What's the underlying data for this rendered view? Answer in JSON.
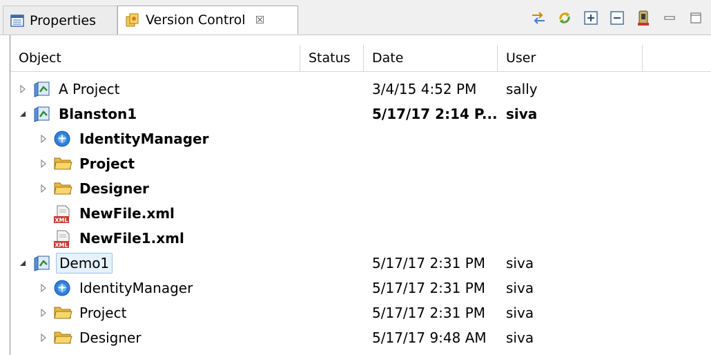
{
  "tabs": {
    "properties": "Properties",
    "version_control": "Version Control",
    "close_glyph": "☒"
  },
  "columns": [
    "Object",
    "Status",
    "Date",
    "User"
  ],
  "rows": [
    {
      "name": "A Project",
      "date": "3/4/15 4:52 PM",
      "user": "sally",
      "icon": "project-icon",
      "twisty": "collapsed",
      "level": 0,
      "bold": false
    },
    {
      "name": "Blanston1",
      "date": "5/17/17 2:14 P...",
      "user": "siva",
      "icon": "project-icon",
      "twisty": "expanded",
      "level": 0,
      "bold": true
    },
    {
      "name": "IdentityManager",
      "date": "",
      "user": "",
      "icon": "identity-manager-icon",
      "twisty": "collapsed",
      "level": 1,
      "bold": true
    },
    {
      "name": "Project",
      "date": "",
      "user": "",
      "icon": "folder-icon",
      "twisty": "collapsed",
      "level": 1,
      "bold": true
    },
    {
      "name": "Designer",
      "date": "",
      "user": "",
      "icon": "folder-icon",
      "twisty": "collapsed",
      "level": 1,
      "bold": true
    },
    {
      "name": "NewFile.xml",
      "date": "",
      "user": "",
      "icon": "xml-file-icon",
      "twisty": "none",
      "level": 1,
      "bold": true
    },
    {
      "name": "NewFile1.xml",
      "date": "",
      "user": "",
      "icon": "xml-file-icon",
      "twisty": "none",
      "level": 1,
      "bold": true
    },
    {
      "name": "Demo1",
      "date": "5/17/17 2:31 PM",
      "user": "siva",
      "icon": "project-icon",
      "twisty": "expanded",
      "level": 0,
      "bold": false,
      "selected": true
    },
    {
      "name": "IdentityManager",
      "date": "5/17/17 2:31 PM",
      "user": "siva",
      "icon": "identity-manager-icon",
      "twisty": "collapsed",
      "level": 1,
      "bold": false
    },
    {
      "name": "Project",
      "date": "5/17/17 2:31 PM",
      "user": "siva",
      "icon": "folder-icon",
      "twisty": "collapsed",
      "level": 1,
      "bold": false
    },
    {
      "name": "Designer",
      "date": "5/17/17 9:48 AM",
      "user": "siva",
      "icon": "folder-icon",
      "twisty": "collapsed",
      "level": 1,
      "bold": false
    }
  ],
  "toolbar_icons": [
    "synchronize-icon",
    "refresh-icon",
    "expand-all-icon",
    "collapse-all-icon",
    "repository-icon",
    "minimize-icon",
    "maximize-icon"
  ]
}
